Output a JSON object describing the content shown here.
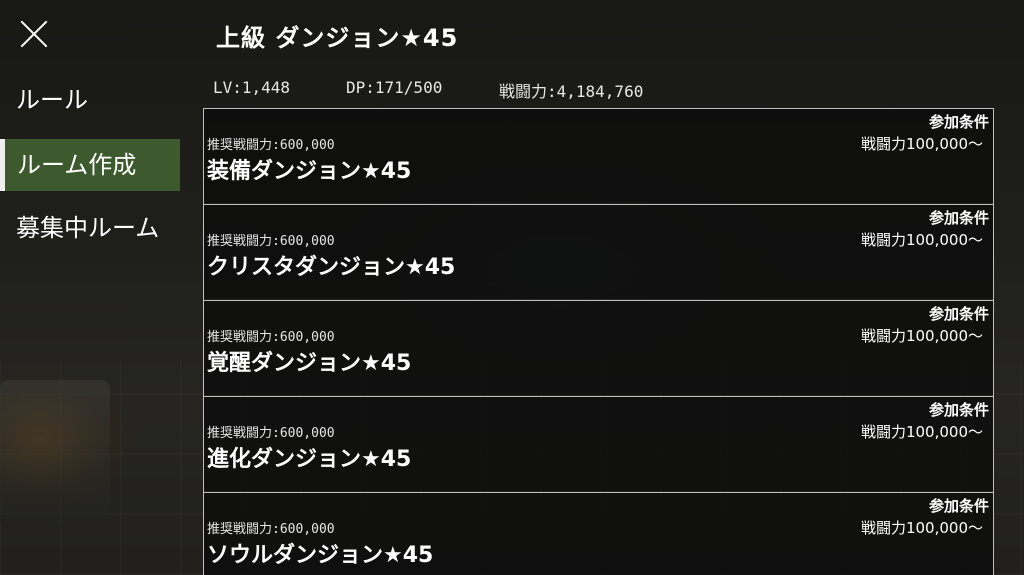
{
  "header": {
    "title": "上級 ダンジョン★45",
    "stats": {
      "lv": "LV:1,448",
      "dp": "DP:171/500",
      "power": "戦闘力:4,184,760"
    }
  },
  "sidebar": {
    "items": [
      {
        "label": "ルール"
      },
      {
        "label": "ルーム作成"
      },
      {
        "label": "募集中ルーム"
      }
    ],
    "active": "ルーム作成"
  },
  "dungeons": [
    {
      "recommended": "推奨戦闘力:600,000",
      "name": "装備ダンジョン★45",
      "condition_label": "参加条件",
      "condition": "戦闘力100,000〜"
    },
    {
      "recommended": "推奨戦闘力:600,000",
      "name": "クリスタダンジョン★45",
      "condition_label": "参加条件",
      "condition": "戦闘力100,000〜"
    },
    {
      "recommended": "推奨戦闘力:600,000",
      "name": "覚醒ダンジョン★45",
      "condition_label": "参加条件",
      "condition": "戦闘力100,000〜"
    },
    {
      "recommended": "推奨戦闘力:600,000",
      "name": "進化ダンジョン★45",
      "condition_label": "参加条件",
      "condition": "戦闘力100,000〜"
    },
    {
      "recommended": "推奨戦闘力:600,000",
      "name": "ソウルダンジョン★45",
      "condition_label": "参加条件",
      "condition": "戦闘力100,000〜"
    }
  ],
  "colors": {
    "sidebar_active": "#3d5a2e",
    "card_bg": "#0c0c0c",
    "border": "#bfbfbf"
  }
}
